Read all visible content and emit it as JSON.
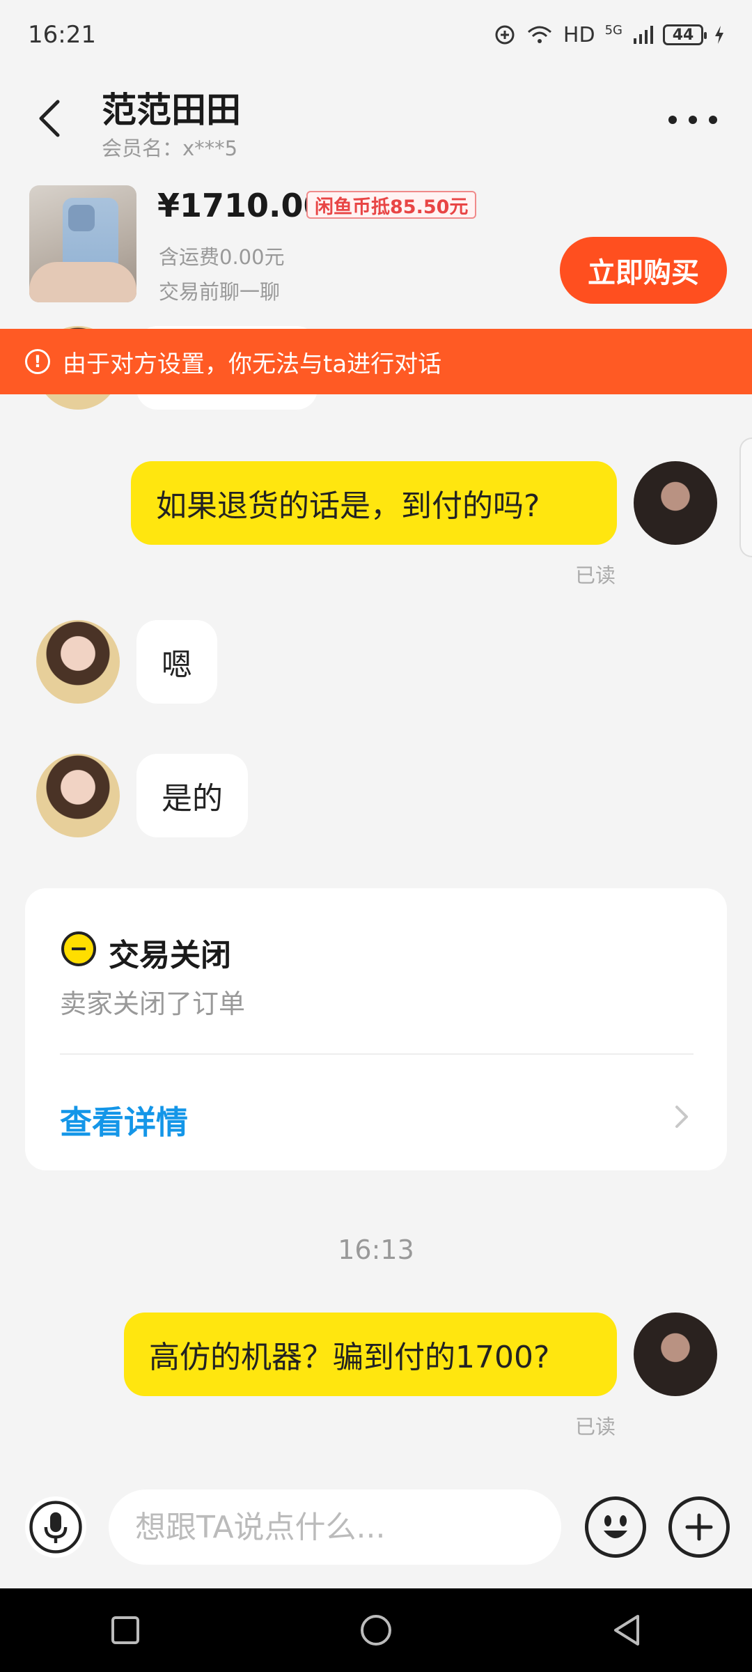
{
  "status_bar": {
    "time": "16:21",
    "network_label": "HD",
    "signal_label": "5G",
    "battery_level": "44"
  },
  "header": {
    "contact_name": "范范田田",
    "member_label": "会员名：x***5"
  },
  "product": {
    "price": "¥1710.00",
    "coin_badge": "闲鱼币抵85.50元",
    "shipping": "含运费0.00元",
    "chat_hint": "交易前聊一聊",
    "buy_label": "立即购买"
  },
  "warning": {
    "text": "由于对方设置，你无法与ta进行对话"
  },
  "messages": [
    {
      "side": "out",
      "text": "如果退货的话是，到付的吗?",
      "status": "已读"
    },
    {
      "side": "in",
      "text": "嗯"
    },
    {
      "side": "in",
      "text": "是的"
    },
    {
      "side": "out",
      "text": "高仿的机器？骗到付的1700?",
      "status": "已读"
    }
  ],
  "order_card": {
    "title": "交易关闭",
    "subtitle": "卖家关闭了订单",
    "link_label": "查看详情"
  },
  "time_divider": "16:13",
  "input_bar": {
    "placeholder": "想跟TA说点什么..."
  },
  "colors": {
    "accent_orange": "#ff4f1f",
    "bubble_yellow": "#ffe60f",
    "link_blue": "#1496e8"
  }
}
